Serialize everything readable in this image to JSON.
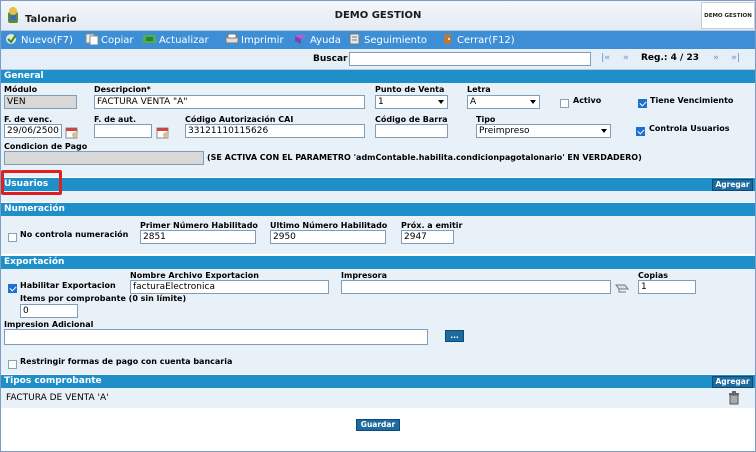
{
  "app": {
    "title": "Talonario",
    "center_title": "DEMO GESTION",
    "logo_text": "DEMO GESTION"
  },
  "toolbar": {
    "nuevo": "Nuevo(F7)",
    "copiar": "Copiar",
    "actualizar": "Actualizar",
    "imprimir": "Imprimir",
    "ayuda": "Ayuda",
    "seguimiento": "Seguimiento",
    "cerrar": "Cerrar(F12)"
  },
  "search": {
    "label": "Buscar",
    "value": "",
    "reg": "Reg.: 4 / 23"
  },
  "general": {
    "header": "General",
    "modulo_label": "Módulo",
    "modulo": "VEN",
    "descripcion_label": "Descripcion*",
    "descripcion": "FACTURA VENTA \"A\"",
    "punto_venta_label": "Punto de Venta",
    "punto_venta": "1",
    "letra_label": "Letra",
    "letra": "A",
    "activo_label": "Activo",
    "tiene_venc_label": "Tiene Vencimiento",
    "fvenc_label": "F. de venc.",
    "fvenc": "29/06/2500",
    "faut_label": "F. de aut.",
    "faut": "",
    "cai_label": "Código Autorización CAI",
    "cai": "33121110115626",
    "barra_label": "Código de Barra",
    "barra": "",
    "tipo_label": "Tipo",
    "tipo": "Preimpreso",
    "controla_label": "Controla Usuarios",
    "condicion_label": "Condicion de Pago",
    "condicion": "",
    "condicion_note": "(SE ACTIVA CON EL PARAMETRO 'admContable.habilita.condicionpagotalonario' EN VERDADERO)"
  },
  "usuarios": {
    "header": "Usuarios",
    "agregar": "Agregar"
  },
  "numeracion": {
    "header": "Numeración",
    "no_controla_label": "No controla numeración",
    "primer_label": "Primer Número Habilitado",
    "primer": "2851",
    "ultimo_label": "Ultimo Número Habilitado",
    "ultimo": "2950",
    "prox_label": "Próx. a emitir",
    "prox": "2947"
  },
  "exportacion": {
    "header": "Exportación",
    "habilitar_label": "Habilitar Exportacion",
    "archivo_label": "Nombre Archivo Exportacion",
    "archivo": "facturaElectronica",
    "impresora_label": "Impresora",
    "impresora": "",
    "copias_label": "Copias",
    "copias": "1",
    "items_label": "Items por comprobante (0 sin límite)",
    "items": "0",
    "impresion_label": "Impresion Adicional",
    "impresion": "",
    "dots": "...",
    "restringir_label": "Restringir formas de pago con cuenta bancaria"
  },
  "tipos": {
    "header": "Tipos comprobante",
    "agregar": "Agregar",
    "item": "FACTURA DE VENTA 'A'"
  },
  "footer": {
    "guardar": "Guardar"
  },
  "colors": {
    "section": "#1e8fc8",
    "toolbar": "#3c8fd6",
    "highlight": "#e02020"
  }
}
